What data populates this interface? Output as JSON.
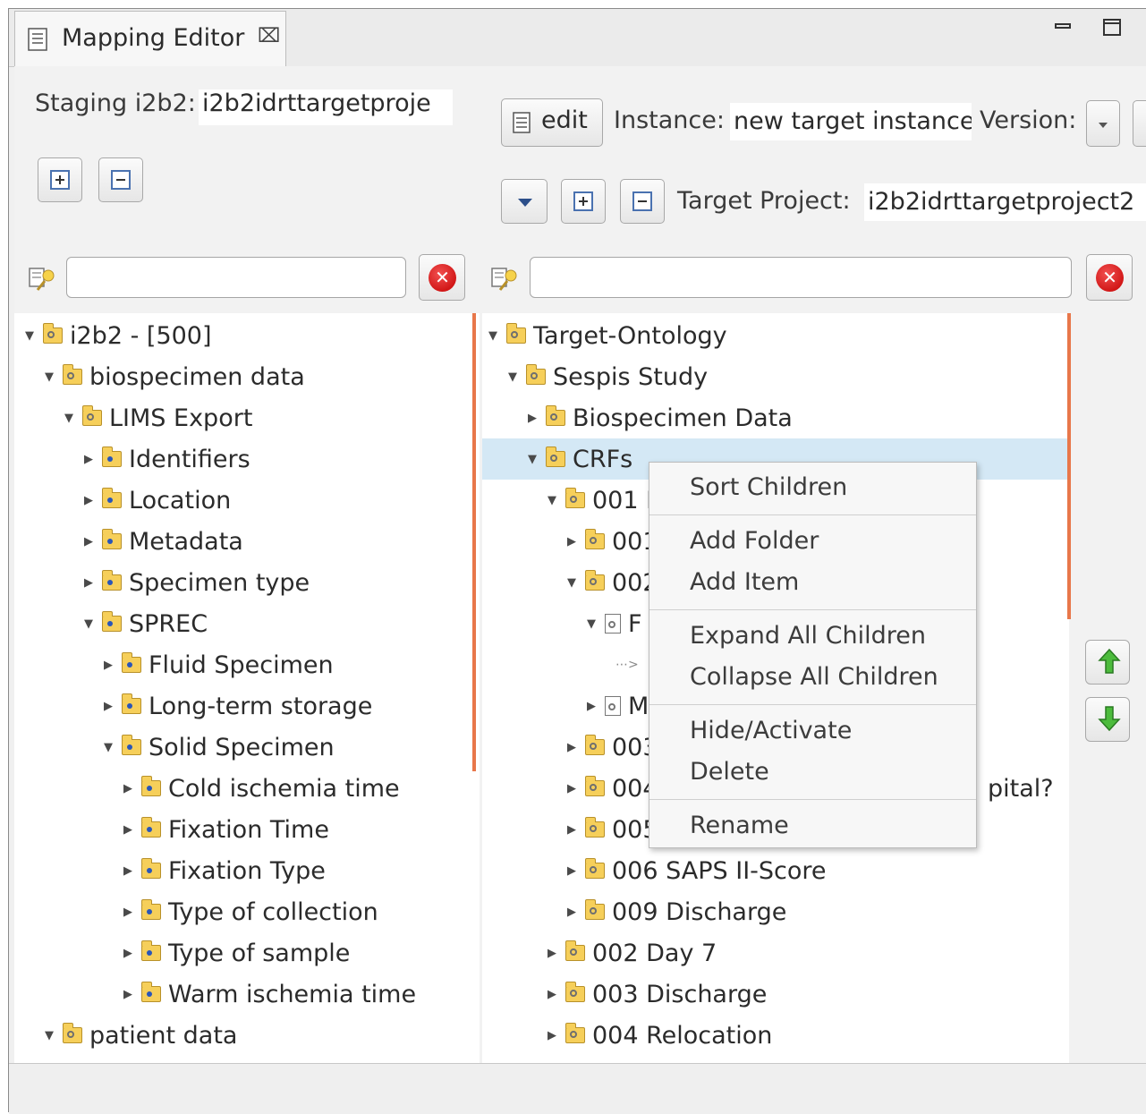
{
  "tab": {
    "title": "Mapping Editor",
    "close_glyph": "⌧"
  },
  "window_controls": {
    "minimize": "▭",
    "maximize": "□"
  },
  "left": {
    "staging_label": "Staging i2b2:",
    "staging_value": "i2b2idrttargetproje",
    "tree": [
      {
        "level": 0,
        "exp": "down",
        "icon": "folder",
        "label": "i2b2 - [500]"
      },
      {
        "level": 1,
        "exp": "down",
        "icon": "folder",
        "label": "biospecimen data"
      },
      {
        "level": 2,
        "exp": "down",
        "icon": "folder",
        "label": "LIMS Export"
      },
      {
        "level": 3,
        "exp": "right",
        "icon": "folder-blue",
        "label": "Identifiers"
      },
      {
        "level": 3,
        "exp": "right",
        "icon": "folder-blue",
        "label": "Location"
      },
      {
        "level": 3,
        "exp": "right",
        "icon": "folder-blue",
        "label": "Metadata"
      },
      {
        "level": 3,
        "exp": "right",
        "icon": "folder-blue",
        "label": "Specimen type"
      },
      {
        "level": 3,
        "exp": "down",
        "icon": "folder-blue",
        "label": "SPREC"
      },
      {
        "level": 4,
        "exp": "right",
        "icon": "folder-blue",
        "label": "Fluid Specimen"
      },
      {
        "level": 4,
        "exp": "right",
        "icon": "folder-blue",
        "label": "Long-term storage"
      },
      {
        "level": 4,
        "exp": "down",
        "icon": "folder-blue",
        "label": "Solid Specimen"
      },
      {
        "level": 5,
        "exp": "right",
        "icon": "folder-blue",
        "label": "Cold ischemia time"
      },
      {
        "level": 5,
        "exp": "right",
        "icon": "folder-blue",
        "label": "Fixation Time"
      },
      {
        "level": 5,
        "exp": "right",
        "icon": "folder-blue",
        "label": "Fixation Type"
      },
      {
        "level": 5,
        "exp": "right",
        "icon": "folder-blue",
        "label": "Type of collection"
      },
      {
        "level": 5,
        "exp": "right",
        "icon": "folder-blue",
        "label": "Type of sample"
      },
      {
        "level": 5,
        "exp": "right",
        "icon": "folder-blue",
        "label": "Warm ischemia time"
      },
      {
        "level": 1,
        "exp": "down",
        "icon": "folder",
        "label": "patient data"
      }
    ]
  },
  "right": {
    "edit_label": "edit",
    "instance_label": "Instance:",
    "instance_value": "new target instance",
    "version_label": "Version:",
    "target_label": "Target Project:",
    "target_value": "i2b2idrttargetproject2",
    "tree": [
      {
        "level": 0,
        "exp": "down",
        "icon": "folder",
        "label": "Target-Ontology"
      },
      {
        "level": 1,
        "exp": "down",
        "icon": "folder",
        "label": "Sespis Study"
      },
      {
        "level": 2,
        "exp": "right",
        "icon": "folder",
        "label": "Biospecimen Data"
      },
      {
        "level": 2,
        "exp": "down",
        "icon": "folder",
        "label": "CRFs"
      },
      {
        "level": 3,
        "exp": "down",
        "icon": "folder",
        "label": "001 I"
      },
      {
        "level": 4,
        "exp": "right",
        "icon": "folder",
        "label": "001"
      },
      {
        "level": 4,
        "exp": "down",
        "icon": "folder",
        "label": "002"
      },
      {
        "level": 5,
        "exp": "down",
        "icon": "file",
        "label": "F"
      },
      {
        "level": 6,
        "exp": "none",
        "icon": "dots",
        "label": ""
      },
      {
        "level": 5,
        "exp": "right",
        "icon": "file",
        "label": "M"
      },
      {
        "level": 4,
        "exp": "right",
        "icon": "folder",
        "label": "003"
      },
      {
        "level": 4,
        "exp": "right",
        "icon": "folder",
        "label": "004",
        "suffix": "pital?"
      },
      {
        "level": 4,
        "exp": "right",
        "icon": "folder",
        "label": "005"
      },
      {
        "level": 4,
        "exp": "right",
        "icon": "folder",
        "label": "006 SAPS II-Score"
      },
      {
        "level": 4,
        "exp": "right",
        "icon": "folder",
        "label": "009 Discharge"
      },
      {
        "level": 3,
        "exp": "right",
        "icon": "folder",
        "label": "002 Day 7"
      },
      {
        "level": 3,
        "exp": "right",
        "icon": "folder",
        "label": "003 Discharge"
      },
      {
        "level": 3,
        "exp": "right",
        "icon": "folder",
        "label": "004 Relocation"
      }
    ]
  },
  "context_menu": {
    "sort": "Sort Children",
    "add_folder": "Add Folder",
    "add_item": "Add Item",
    "expand_all": "Expand All Children",
    "collapse_all": "Collapse All Children",
    "hide_activate": "Hide/Activate",
    "delete": "Delete",
    "rename": "Rename"
  },
  "icons": {
    "expand-all": "expand-all-icon",
    "collapse-all": "collapse-all-icon",
    "filter": "filter-icon",
    "clear": "clear-icon",
    "move-up": "arrow-up-icon",
    "move-down": "arrow-down-icon"
  },
  "colors": {
    "selection": "#d4e8f5",
    "accent_orange": "#e8774a",
    "clear_red": "#c40000",
    "arrow_green": "#2ea02e"
  }
}
